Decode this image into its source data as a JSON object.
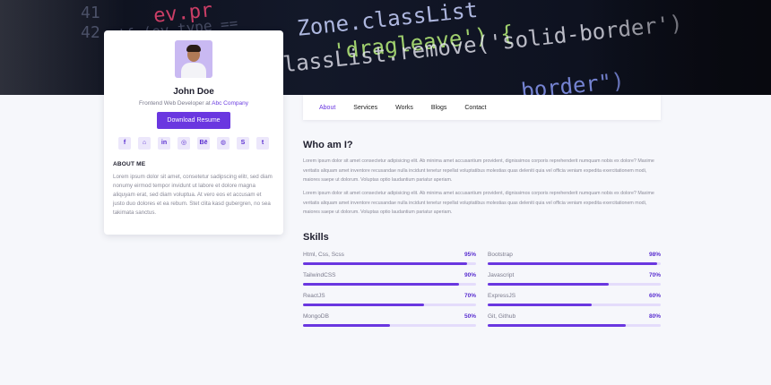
{
  "hero": {
    "code_lines": [
      "ev.pr",
      "if (ev.type ==",
      "Zone.classList",
      "'dragleave') {",
      "classList.remove('solid-border')",
      "border\")"
    ],
    "line_numbers": [
      "41",
      "42"
    ]
  },
  "profile": {
    "name": "John Doe",
    "role_prefix": "Frontend Web Developer at ",
    "company": "Abc Company",
    "resume_button": "Download Resume",
    "socials": [
      {
        "icon": "facebook-icon",
        "glyph": "f"
      },
      {
        "icon": "github-icon",
        "glyph": "⌂"
      },
      {
        "icon": "linkedin-icon",
        "glyph": "in"
      },
      {
        "icon": "instagram-icon",
        "glyph": "◎"
      },
      {
        "icon": "behance-icon",
        "glyph": "Bē"
      },
      {
        "icon": "dribbble-icon",
        "glyph": "◍"
      },
      {
        "icon": "skype-icon",
        "glyph": "S"
      },
      {
        "icon": "twitter-icon",
        "glyph": "t"
      }
    ],
    "about_heading": "ABOUT ME",
    "about_text": "Lorem ipsum dolor sit amet, consetetur sadipscing elitr, sed diam nonumy eirmod tempor invidunt ut labore et dolore magna aliquyam erat, sed diam voluptua. At vero eos et accusam et justo duo dolores et ea rebum. Stet clita kasd gubergren, no sea takimata sanctus."
  },
  "nav": {
    "items": [
      "About",
      "Services",
      "Works",
      "Blogs",
      "Contact"
    ],
    "active": "About"
  },
  "main": {
    "who_title": "Who am I?",
    "paragraph1": "Lorem ipsum dolor sit amet consectetur adipisicing elit. Ab minima amet accusantium provident, dignissimos corporis reprehenderit numquam nobis ex dolore? Maxime veritatis aliquam amet inventore recusandae nulla incidunt tenetur repellat voluptatibus molestias quas deleniti quia vel officia veniam expedita exercitationem modi, maiores saepe ut dolorum. Voluptas optio laudantium pariatur aperiam.",
    "paragraph2": "Lorem ipsum dolor sit amet consectetur adipisicing elit. Ab minima amet accusantium provident, dignissimos corporis reprehenderit numquam nobis ex dolore? Maxime veritatis aliquam amet inventore recusandae nulla incidunt tenetur repellat voluptatibus molestias quas deleniti quia vel officia veniam expedita exercitationem modi, maiores saepe ut dolorum. Voluptas optio laudantium pariatur aperiam.",
    "skills_title": "Skills",
    "skills": [
      {
        "name": "Html, Css, Scss",
        "percent": "95%",
        "level": 95
      },
      {
        "name": "Bootstrap",
        "percent": "98%",
        "level": 98
      },
      {
        "name": "TailwindCSS",
        "percent": "90%",
        "level": 90
      },
      {
        "name": "Javascript",
        "percent": "70%",
        "level": 70
      },
      {
        "name": "ReactJS",
        "percent": "70%",
        "level": 70
      },
      {
        "name": "ExpressJS",
        "percent": "60%",
        "level": 60
      },
      {
        "name": "MongoDB",
        "percent": "50%",
        "level": 50
      },
      {
        "name": "Git, Github",
        "percent": "80%",
        "level": 80
      }
    ]
  },
  "colors": {
    "accent": "#6a37e0",
    "track": "#e4dcfb"
  }
}
